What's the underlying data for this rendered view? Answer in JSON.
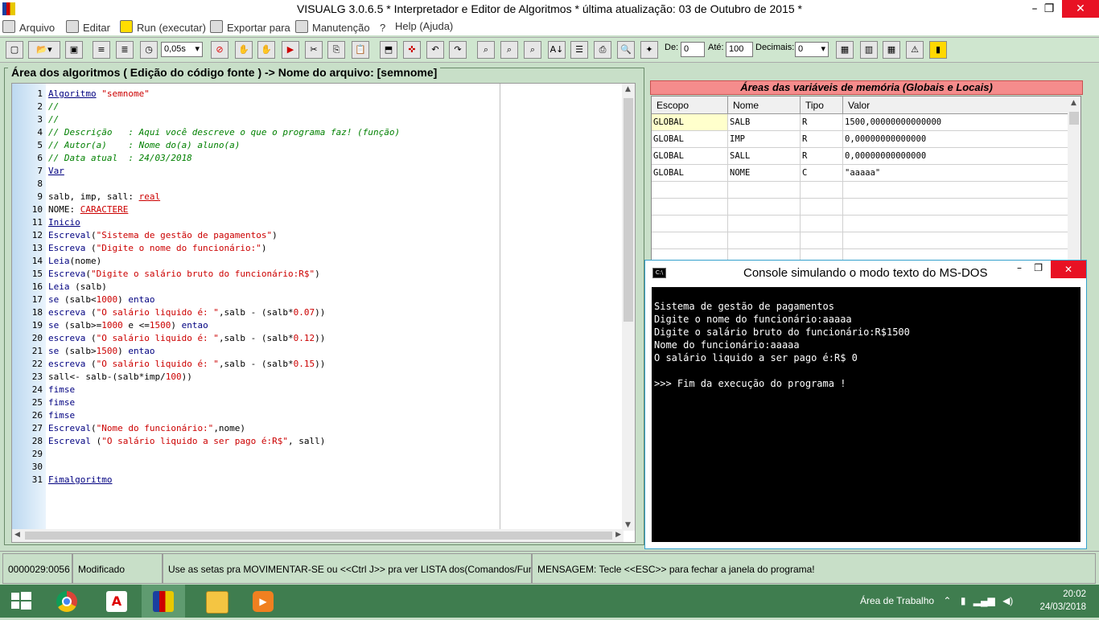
{
  "window": {
    "title": "VISUALG 3.0.6.5 * Interpretador e Editor de Algoritmos * última atualização: 03 de Outubro de 2015 *",
    "min_glyph": "–",
    "max_glyph": "❐",
    "close_glyph": "✕"
  },
  "menu": [
    "Arquivo",
    "Editar",
    "Run (executar)",
    "Exportar para",
    "Manutenção",
    "Help (Ajuda)"
  ],
  "toolbar": {
    "speed_value": "0,05s",
    "de_label": "De:",
    "de_value": "0",
    "ate_label": "Até:",
    "ate_value": "100",
    "decimais_label": "Decimais:",
    "decimais_value": "0"
  },
  "editor": {
    "header": "Área dos algoritmos ( Edição do código fonte ) -> Nome do arquivo: [semnome]",
    "lines": [
      [
        {
          "t": "Algoritmo",
          "c": "kw"
        },
        {
          "t": " ",
          "c": ""
        },
        {
          "t": "\"semnome\"",
          "c": "st"
        }
      ],
      [
        {
          "t": "//",
          "c": "cm"
        }
      ],
      [
        {
          "t": "//",
          "c": "cm"
        }
      ],
      [
        {
          "t": "// Descrição   : Aqui você descreve o que o programa faz! (função)",
          "c": "cm"
        }
      ],
      [
        {
          "t": "// Autor(a)    : Nome do(a) aluno(a)",
          "c": "cm"
        }
      ],
      [
        {
          "t": "// Data atual  : 24/03/2018",
          "c": "cm"
        }
      ],
      [
        {
          "t": "Var",
          "c": "kw"
        }
      ],
      [],
      [
        {
          "t": "salb, imp, sall: ",
          "c": ""
        },
        {
          "t": "real",
          "c": "ty"
        }
      ],
      [
        {
          "t": "NOME: ",
          "c": ""
        },
        {
          "t": "CARACTERE",
          "c": "ty"
        }
      ],
      [
        {
          "t": "Inicio",
          "c": "kw"
        }
      ],
      [
        {
          "t": "Escreval",
          "c": "kw2"
        },
        {
          "t": "(",
          "c": ""
        },
        {
          "t": "\"Sistema de gestão de pagamentos\"",
          "c": "st"
        },
        {
          "t": ")",
          "c": ""
        }
      ],
      [
        {
          "t": "Escreva",
          "c": "kw2"
        },
        {
          "t": " (",
          "c": ""
        },
        {
          "t": "\"Digite o nome do funcionário:\"",
          "c": "st"
        },
        {
          "t": ")",
          "c": ""
        }
      ],
      [
        {
          "t": "Leia",
          "c": "kw2"
        },
        {
          "t": "(nome)",
          "c": ""
        }
      ],
      [
        {
          "t": "Escreva",
          "c": "kw2"
        },
        {
          "t": "(",
          "c": ""
        },
        {
          "t": "\"Digite o salário bruto do funcionário:R$\"",
          "c": "st"
        },
        {
          "t": ")",
          "c": ""
        }
      ],
      [
        {
          "t": "Leia",
          "c": "kw2"
        },
        {
          "t": " (salb)",
          "c": ""
        }
      ],
      [
        {
          "t": "se",
          "c": "kw2"
        },
        {
          "t": " (salb<",
          "c": ""
        },
        {
          "t": "1000",
          "c": "nm"
        },
        {
          "t": ") ",
          "c": ""
        },
        {
          "t": "entao",
          "c": "kw2"
        }
      ],
      [
        {
          "t": "escreva",
          "c": "kw2"
        },
        {
          "t": " (",
          "c": ""
        },
        {
          "t": "\"O salário liquido é: \"",
          "c": "st"
        },
        {
          "t": ",salb - (salb*",
          "c": ""
        },
        {
          "t": "0.07",
          "c": "nm"
        },
        {
          "t": "))",
          "c": ""
        }
      ],
      [
        {
          "t": "se",
          "c": "kw2"
        },
        {
          "t": " (salb>=",
          "c": ""
        },
        {
          "t": "1000",
          "c": "nm"
        },
        {
          "t": " e <=",
          "c": ""
        },
        {
          "t": "1500",
          "c": "nm"
        },
        {
          "t": ") ",
          "c": ""
        },
        {
          "t": "entao",
          "c": "kw2"
        }
      ],
      [
        {
          "t": "escreva",
          "c": "kw2"
        },
        {
          "t": " (",
          "c": ""
        },
        {
          "t": "\"O salário liquido é: \"",
          "c": "st"
        },
        {
          "t": ",salb - (salb*",
          "c": ""
        },
        {
          "t": "0.12",
          "c": "nm"
        },
        {
          "t": "))",
          "c": ""
        }
      ],
      [
        {
          "t": "se",
          "c": "kw2"
        },
        {
          "t": " (salb>",
          "c": ""
        },
        {
          "t": "1500",
          "c": "nm"
        },
        {
          "t": ") ",
          "c": ""
        },
        {
          "t": "entao",
          "c": "kw2"
        }
      ],
      [
        {
          "t": "escreva",
          "c": "kw2"
        },
        {
          "t": " (",
          "c": ""
        },
        {
          "t": "\"O salário liquido é: \"",
          "c": "st"
        },
        {
          "t": ",salb - (salb*",
          "c": ""
        },
        {
          "t": "0.15",
          "c": "nm"
        },
        {
          "t": "))",
          "c": ""
        }
      ],
      [
        {
          "t": "sall<- salb-(salb*imp/",
          "c": ""
        },
        {
          "t": "100",
          "c": "nm"
        },
        {
          "t": "))",
          "c": ""
        }
      ],
      [
        {
          "t": "fimse",
          "c": "kw2"
        }
      ],
      [
        {
          "t": "fimse",
          "c": "kw2"
        }
      ],
      [
        {
          "t": "fimse",
          "c": "kw2"
        }
      ],
      [
        {
          "t": "Escreval",
          "c": "kw2"
        },
        {
          "t": "(",
          "c": ""
        },
        {
          "t": "\"Nome do funcionário:\"",
          "c": "st"
        },
        {
          "t": ",nome)",
          "c": ""
        }
      ],
      [
        {
          "t": "Escreval",
          "c": "kw2"
        },
        {
          "t": " (",
          "c": ""
        },
        {
          "t": "\"O salário liquido a ser pago é:R$\"",
          "c": "st"
        },
        {
          "t": ", sall)",
          "c": ""
        }
      ],
      [],
      [],
      [
        {
          "t": "Fimalgoritmo",
          "c": "kw"
        }
      ]
    ]
  },
  "variables": {
    "header": "Áreas das variáveis de memória (Globais e Locais)",
    "columns": [
      "Escopo",
      "Nome",
      "Tipo",
      "Valor"
    ],
    "rows": [
      [
        "GLOBAL",
        "SALB",
        "R",
        "1500,00000000000000"
      ],
      [
        "GLOBAL",
        "IMP",
        "R",
        "0,00000000000000"
      ],
      [
        "GLOBAL",
        "SALL",
        "R",
        "0,00000000000000"
      ],
      [
        "GLOBAL",
        "NOME",
        "C",
        "\"aaaaa\""
      ]
    ]
  },
  "console": {
    "title": "Console simulando o modo texto do MS-DOS",
    "lines": [
      "Sistema de gestão de pagamentos",
      "Digite o nome do funcionário:aaaaa",
      "Digite o salário bruto do funcionário:R$1500",
      "Nome do funcionário:aaaaa",
      "O salário liquido a ser pago é:R$ 0",
      "",
      ">>> Fim da execução do programa !"
    ]
  },
  "status": {
    "position": "0000029:0056",
    "state": "Modificado",
    "hint": "Use as setas pra MOVIMENTAR-SE ou <<Ctrl J>> pra ver LISTA dos(Comandos/Funçõ",
    "message": "MENSAGEM: Tecle <<ESC>> para fechar a janela do programa!"
  },
  "taskbar": {
    "tray_label": "Área de Trabalho",
    "time": "20:02",
    "date": "24/03/2018"
  },
  "colors": {
    "accent_green": "#c8dfc8",
    "taskbar": "#3f7d4f",
    "vars_header": "#f58c8c",
    "close_red": "#e81123"
  }
}
